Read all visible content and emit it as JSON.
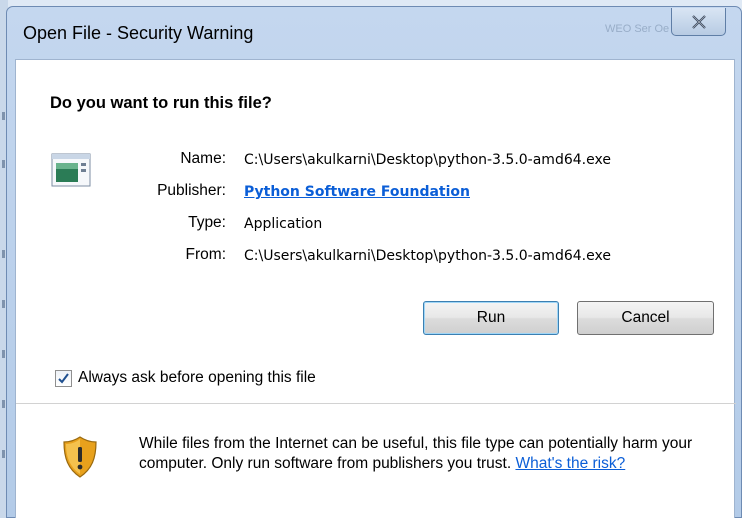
{
  "window": {
    "title": "Open File - Security Warning",
    "faded_title_text": "WEO Ser Oe",
    "close_icon": "close-icon"
  },
  "prompt": {
    "question": "Do you want to run this file?"
  },
  "file_info": {
    "name_label": "Name:",
    "name_value": "C:\\Users\\akulkarni\\Desktop\\python-3.5.0-amd64.exe",
    "publisher_label": "Publisher:",
    "publisher_value": "Python Software Foundation",
    "type_label": "Type:",
    "type_value": "Application",
    "from_label": "From:",
    "from_value": "C:\\Users\\akulkarni\\Desktop\\python-3.5.0-amd64.exe"
  },
  "buttons": {
    "run": "Run",
    "cancel": "Cancel"
  },
  "checkbox": {
    "label": "Always ask before opening this file",
    "checked": true
  },
  "warning": {
    "text": "While files from the Internet can be useful, this file type can potentially harm your computer. Only run software from publishers you trust. ",
    "link": "What's the risk?"
  },
  "colors": {
    "link": "#0b5ed7",
    "title_bar": "#b3cbe8",
    "shield": "#f0b429"
  },
  "icons": {
    "app": "application-window-icon",
    "shield": "warning-shield-icon",
    "check": "checkmark-icon"
  }
}
